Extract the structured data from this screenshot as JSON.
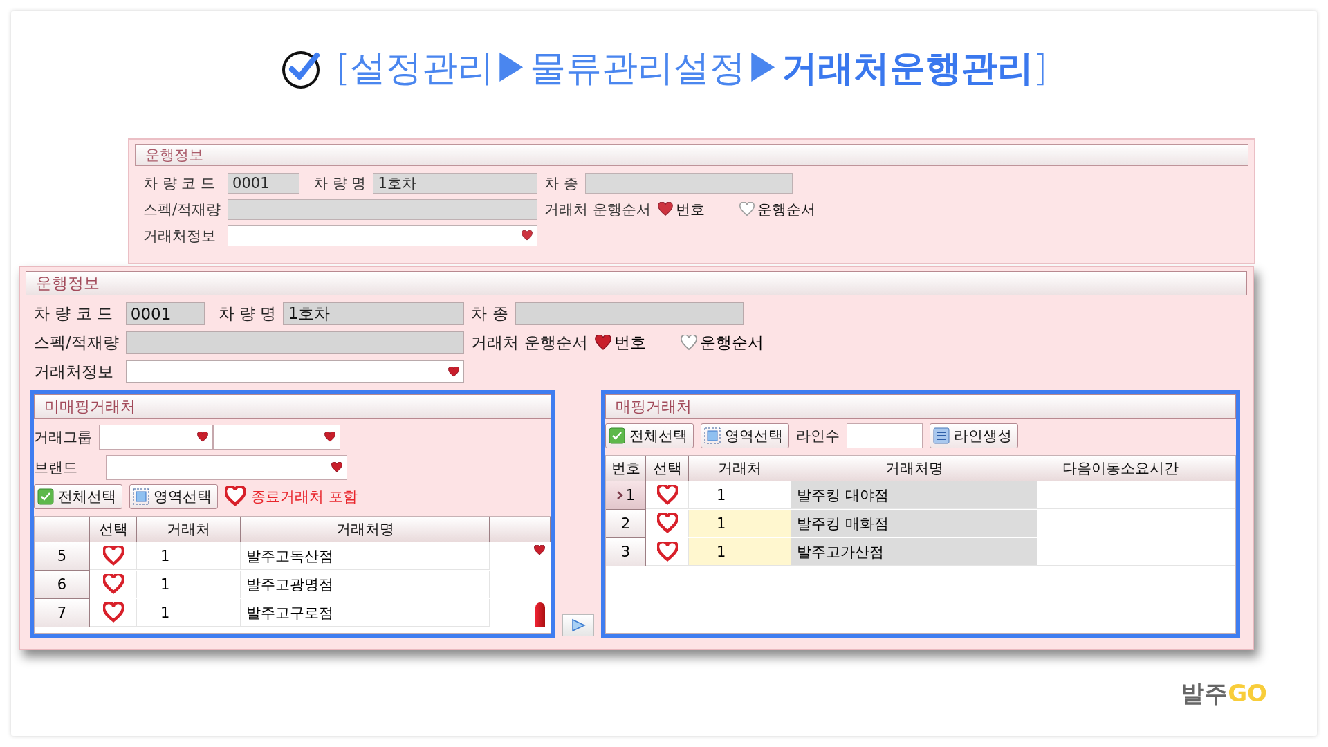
{
  "title": "[설정관리▶물류관리설정▶**거래처운행관리**]",
  "back_form": {
    "section_title": "운행정보",
    "code_label": "차 량 코 드",
    "code_value": "0001",
    "name_label": "차 량 명",
    "name_value": "1호차",
    "type_label": "차 종",
    "spec_label": "스펙/적재량",
    "order_label": "거래처 운행순서",
    "order_options": [
      {
        "label": "번호",
        "selected": true
      },
      {
        "label": "운행순서",
        "selected": false
      }
    ],
    "client_label": "거래처정보"
  },
  "front_form": {
    "section_title": "운행정보",
    "code_label": "차 량 코 드",
    "code_value": "0001",
    "name_label": "차 량 명",
    "name_value": "1호차",
    "type_label": "차 종",
    "spec_label": "스펙/적재량",
    "order_label": "거래처 운행순서",
    "order_options": [
      {
        "label": "번호",
        "selected": true
      },
      {
        "label": "운행순서",
        "selected": false
      }
    ],
    "client_label": "거래처정보"
  },
  "unmapped": {
    "title": "미매핑거래처",
    "group_label": "거래그룹",
    "brand_label": "브랜드",
    "select_all": "전체선택",
    "select_area": "영역선택",
    "include_closed": {
      "label": "종료거래처 포함",
      "checked": true
    },
    "columns": [
      "선택",
      "거래처",
      "거래처명"
    ],
    "rows": [
      {
        "number": "5",
        "checked": true,
        "code": "1",
        "name": "발주고독산점"
      },
      {
        "number": "6",
        "checked": true,
        "code": "1",
        "name": "발주고광명점"
      },
      {
        "number": "7",
        "checked": true,
        "code": "1",
        "name": "발주고구로점"
      }
    ]
  },
  "mapped": {
    "title": "매핑거래처",
    "select_all": "전체선택",
    "select_area": "영역선택",
    "line_count_label": "라인수",
    "create_lines": "라인생성",
    "columns": [
      "번호",
      "선택",
      "거래처",
      "거래처명",
      "다음이동소요시간"
    ],
    "rows": [
      {
        "number": "1",
        "selected": true,
        "checked": true,
        "code": "1",
        "highlighted": false,
        "name": "발주킹 대야점"
      },
      {
        "number": "2",
        "selected": false,
        "checked": true,
        "code": "1",
        "highlighted": true,
        "name": "발주킹 매화점"
      },
      {
        "number": "3",
        "selected": false,
        "checked": true,
        "code": "1",
        "highlighted": true,
        "name": "발주고가산점"
      }
    ]
  },
  "logo": {
    "text": "발주",
    "accent": "GO"
  }
}
